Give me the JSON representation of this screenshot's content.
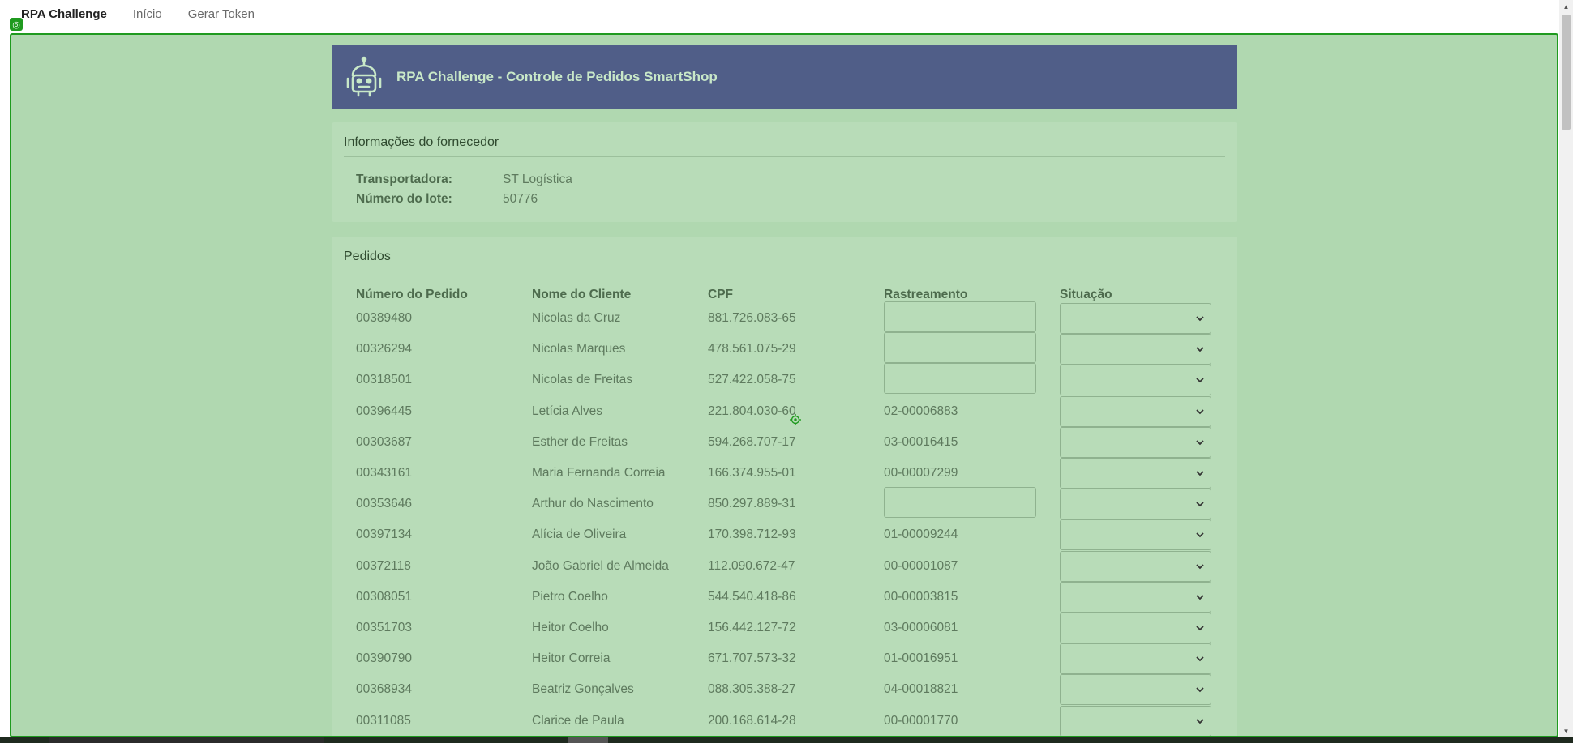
{
  "nav": {
    "brand": "RPA Challenge",
    "links": [
      "Início",
      "Gerar Token"
    ]
  },
  "header": {
    "title": "RPA Challenge - Controle de Pedidos SmartShop"
  },
  "supplier": {
    "title": "Informações do fornecedor",
    "fields": [
      {
        "label": "Transportadora:",
        "value": "ST Logística"
      },
      {
        "label": "Número do lote:",
        "value": "50776"
      }
    ]
  },
  "orders": {
    "title": "Pedidos",
    "columns": [
      "Número do Pedido",
      "Nome do Cliente",
      "CPF",
      "Rastreamento",
      "Situação"
    ],
    "rows": [
      {
        "id": "00389480",
        "name": "Nicolas da Cruz",
        "cpf": "881.726.083-65",
        "tracking": ""
      },
      {
        "id": "00326294",
        "name": "Nicolas Marques",
        "cpf": "478.561.075-29",
        "tracking": ""
      },
      {
        "id": "00318501",
        "name": "Nicolas de Freitas",
        "cpf": "527.422.058-75",
        "tracking": ""
      },
      {
        "id": "00396445",
        "name": "Letícia Alves",
        "cpf": "221.804.030-60",
        "tracking": "02-00006883"
      },
      {
        "id": "00303687",
        "name": "Esther de Freitas",
        "cpf": "594.268.707-17",
        "tracking": "03-00016415"
      },
      {
        "id": "00343161",
        "name": "Maria Fernanda Correia",
        "cpf": "166.374.955-01",
        "tracking": "00-00007299"
      },
      {
        "id": "00353646",
        "name": "Arthur do Nascimento",
        "cpf": "850.297.889-31",
        "tracking": ""
      },
      {
        "id": "00397134",
        "name": "Alícia de Oliveira",
        "cpf": "170.398.712-93",
        "tracking": "01-00009244"
      },
      {
        "id": "00372118",
        "name": "João Gabriel de Almeida",
        "cpf": "112.090.672-47",
        "tracking": "00-00001087"
      },
      {
        "id": "00308051",
        "name": "Pietro Coelho",
        "cpf": "544.540.418-86",
        "tracking": "00-00003815"
      },
      {
        "id": "00351703",
        "name": "Heitor Coelho",
        "cpf": "156.442.127-72",
        "tracking": "03-00006081"
      },
      {
        "id": "00390790",
        "name": "Heitor Correia",
        "cpf": "671.707.573-32",
        "tracking": "01-00016951"
      },
      {
        "id": "00368934",
        "name": "Beatriz Gonçalves",
        "cpf": "088.305.388-27",
        "tracking": "04-00018821"
      },
      {
        "id": "00311085",
        "name": "Clarice de Paula",
        "cpf": "200.168.614-28",
        "tracking": "00-00001770"
      }
    ]
  },
  "colors": {
    "header_bg": "#505e88",
    "overlay_bg": "#b0d8b0",
    "overlay_border": "#1f9a1f"
  }
}
